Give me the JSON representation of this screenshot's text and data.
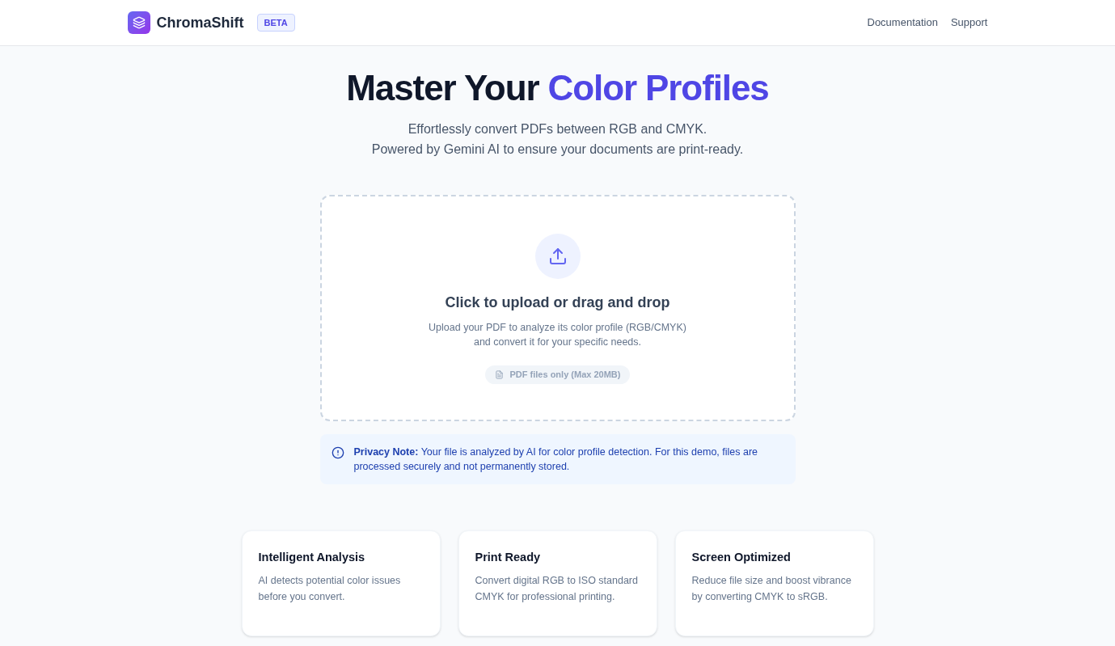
{
  "header": {
    "brand": "ChromaShift",
    "badge": "BETA",
    "nav": [
      "Documentation",
      "Support"
    ]
  },
  "hero": {
    "title_lead": "Master Your",
    "title_highlight": "Color Profiles",
    "subtitle_lines": [
      "Effortlessly convert PDFs between RGB and CMYK.",
      "Powered by Gemini AI to ensure your documents are print-ready."
    ]
  },
  "dropzone": {
    "title": "Click to upload or drag and drop",
    "description_lines": [
      "Upload your PDF to analyze its color profile (RGB/CMYK)",
      "and convert it for your specific needs."
    ],
    "hint": "PDF files only (Max 20MB)"
  },
  "notice": {
    "text": "**Privacy Note:** Your file is analyzed by AI for color profile detection. For this demo, files are processed securely and not permanently stored."
  },
  "features": [
    {
      "title": "Intelligent Analysis",
      "text": "AI detects potential color issues before you convert."
    },
    {
      "title": "Print Ready",
      "text": "Convert digital RGB to ISO standard CMYK for professional printing."
    },
    {
      "title": "Screen Optimized",
      "text": "Reduce file size and boost vibrance by converting CMYK to sRGB."
    }
  ]
}
